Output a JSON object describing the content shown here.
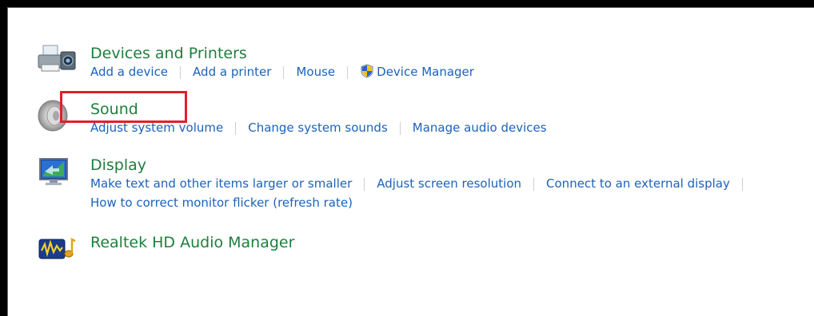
{
  "categories": {
    "devices": {
      "title": "Devices and Printers",
      "links": [
        "Add a device",
        "Add a printer",
        "Mouse",
        "Device Manager"
      ],
      "icon": "printer-icon"
    },
    "sound": {
      "title": "Sound",
      "links": [
        "Adjust system volume",
        "Change system sounds",
        "Manage audio devices"
      ],
      "icon": "speaker-icon"
    },
    "display": {
      "title": "Display",
      "links": [
        "Make text and other items larger or smaller",
        "Adjust screen resolution",
        "Connect to an external display"
      ],
      "links2": [
        "How to correct monitor flicker (refresh rate)"
      ],
      "icon": "monitor-icon"
    },
    "realtek": {
      "title": "Realtek HD Audio Manager",
      "icon": "realtek-audio-icon"
    }
  },
  "colors": {
    "title": "#1e7f3c",
    "link": "#1c62b9",
    "highlight": "#e0202a"
  }
}
